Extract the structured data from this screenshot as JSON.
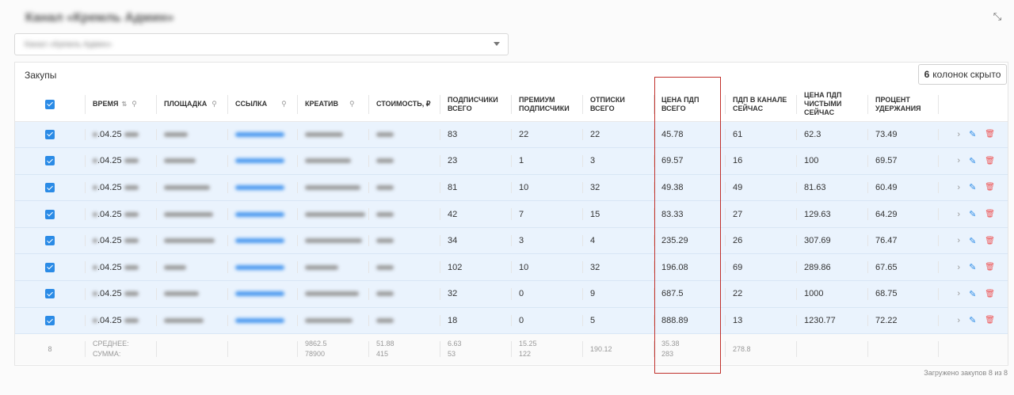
{
  "header": {
    "title": "Канал «Кремль Админ»"
  },
  "channel_select": {
    "value": "Канал «Кремль Админ»"
  },
  "card": {
    "title": "Закупы",
    "hidden_count": "6",
    "hidden_label": "колонок скрыто"
  },
  "columns": {
    "time": "Время",
    "platform": "Площадка",
    "link": "Ссылка",
    "creative": "Креатив",
    "cost": "Стоимость, ₽",
    "subs_total": "Подписчики всего",
    "premium_subs": "Премиум подписчики",
    "unsubs_total": "Отписки всего",
    "price_per_sub_total": "Цена ПДП всего",
    "subs_now": "ПДП в канале сейчас",
    "price_net_now": "Цена ПДП чистыми сейчас",
    "retention": "Процент удержания"
  },
  "rows": [
    {
      "date": ".04.25",
      "subs": "83",
      "premium": "22",
      "unsubs": "22",
      "price_total": "45.78",
      "now": "61",
      "price_net": "62.3",
      "retention": "73.49"
    },
    {
      "date": ".04.25",
      "subs": "23",
      "premium": "1",
      "unsubs": "3",
      "price_total": "69.57",
      "now": "16",
      "price_net": "100",
      "retention": "69.57"
    },
    {
      "date": ".04.25",
      "subs": "81",
      "premium": "10",
      "unsubs": "32",
      "price_total": "49.38",
      "now": "49",
      "price_net": "81.63",
      "retention": "60.49"
    },
    {
      "date": ".04.25",
      "subs": "42",
      "premium": "7",
      "unsubs": "15",
      "price_total": "83.33",
      "now": "27",
      "price_net": "129.63",
      "retention": "64.29"
    },
    {
      "date": ".04.25",
      "subs": "34",
      "premium": "3",
      "unsubs": "4",
      "price_total": "235.29",
      "now": "26",
      "price_net": "307.69",
      "retention": "76.47"
    },
    {
      "date": ".04.25",
      "subs": "102",
      "premium": "10",
      "unsubs": "32",
      "price_total": "196.08",
      "now": "69",
      "price_net": "289.86",
      "retention": "67.65"
    },
    {
      "date": ".04.25",
      "subs": "32",
      "premium": "0",
      "unsubs": "9",
      "price_total": "687.5",
      "now": "22",
      "price_net": "1000",
      "retention": "68.75"
    },
    {
      "date": ".04.25",
      "subs": "18",
      "premium": "0",
      "unsubs": "5",
      "price_total": "888.89",
      "now": "13",
      "price_net": "1230.77",
      "retention": "72.22"
    }
  ],
  "footer": {
    "count": "8",
    "avg_label": "СРЕДНЕЕ:",
    "sum_label": "СУММА:",
    "cost_avg": "9862.5",
    "cost_sum": "78900",
    "subs_avg": "51.88",
    "subs_sum": "415",
    "premium_avg": "6.63",
    "premium_sum": "53",
    "unsubs_avg": "15.25",
    "unsubs_sum": "122",
    "price_total_avg": "190.12",
    "now_avg": "35.38",
    "now_sum": "283",
    "price_net_avg": "278.8"
  },
  "status": {
    "loaded": "Загружено закупов 8 из 8"
  },
  "colors": {
    "accent": "#2b8be6",
    "row_selected": "#eaf3fd",
    "highlight": "#c0302b",
    "delete": "#ee5555"
  },
  "icons": [
    "collapse-icon",
    "sort-icon",
    "search-icon",
    "chevron-right-icon",
    "pencil-icon",
    "trash-icon",
    "checkbox-icon"
  ]
}
